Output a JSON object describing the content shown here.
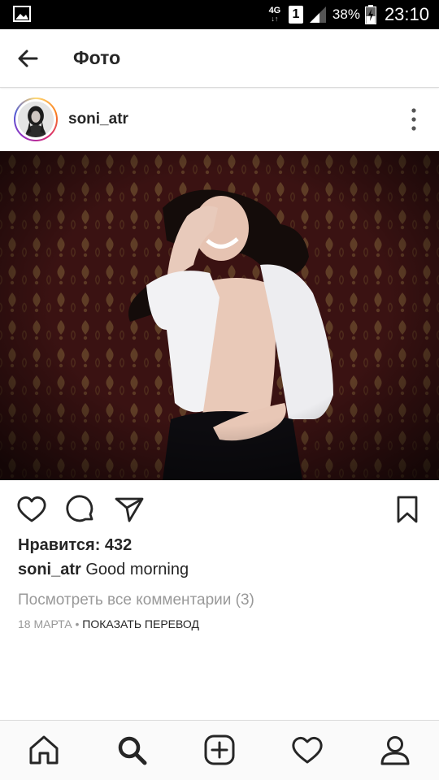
{
  "status_bar": {
    "network": "4G",
    "network_arrows": "↓↑",
    "sim": "1",
    "battery": "38%",
    "time": "23:10"
  },
  "header": {
    "title": "Фото",
    "back_icon": "arrow-left-icon"
  },
  "post": {
    "username": "soni_atr",
    "likes_text": "Нравится: 432",
    "caption_user": "soni_atr",
    "caption_text": " Good morning",
    "view_comments": "Посмотреть все комментарии (3)",
    "date": "18 МАРТА",
    "separator": " • ",
    "translate": "ПОКАЗАТЬ ПЕРЕВОД"
  },
  "icons": {
    "more": "more-vertical-icon",
    "like": "heart-outline-icon",
    "comment": "comment-bubble-icon",
    "share": "send-paper-plane-icon",
    "save": "bookmark-outline-icon"
  },
  "bottom_nav": [
    "home-icon",
    "search-icon",
    "add-post-icon",
    "activity-heart-icon",
    "profile-icon"
  ],
  "colors": {
    "text": "#262626",
    "muted": "#999999",
    "divider": "#dbdbdb",
    "wallpaper": "#3a1212"
  }
}
